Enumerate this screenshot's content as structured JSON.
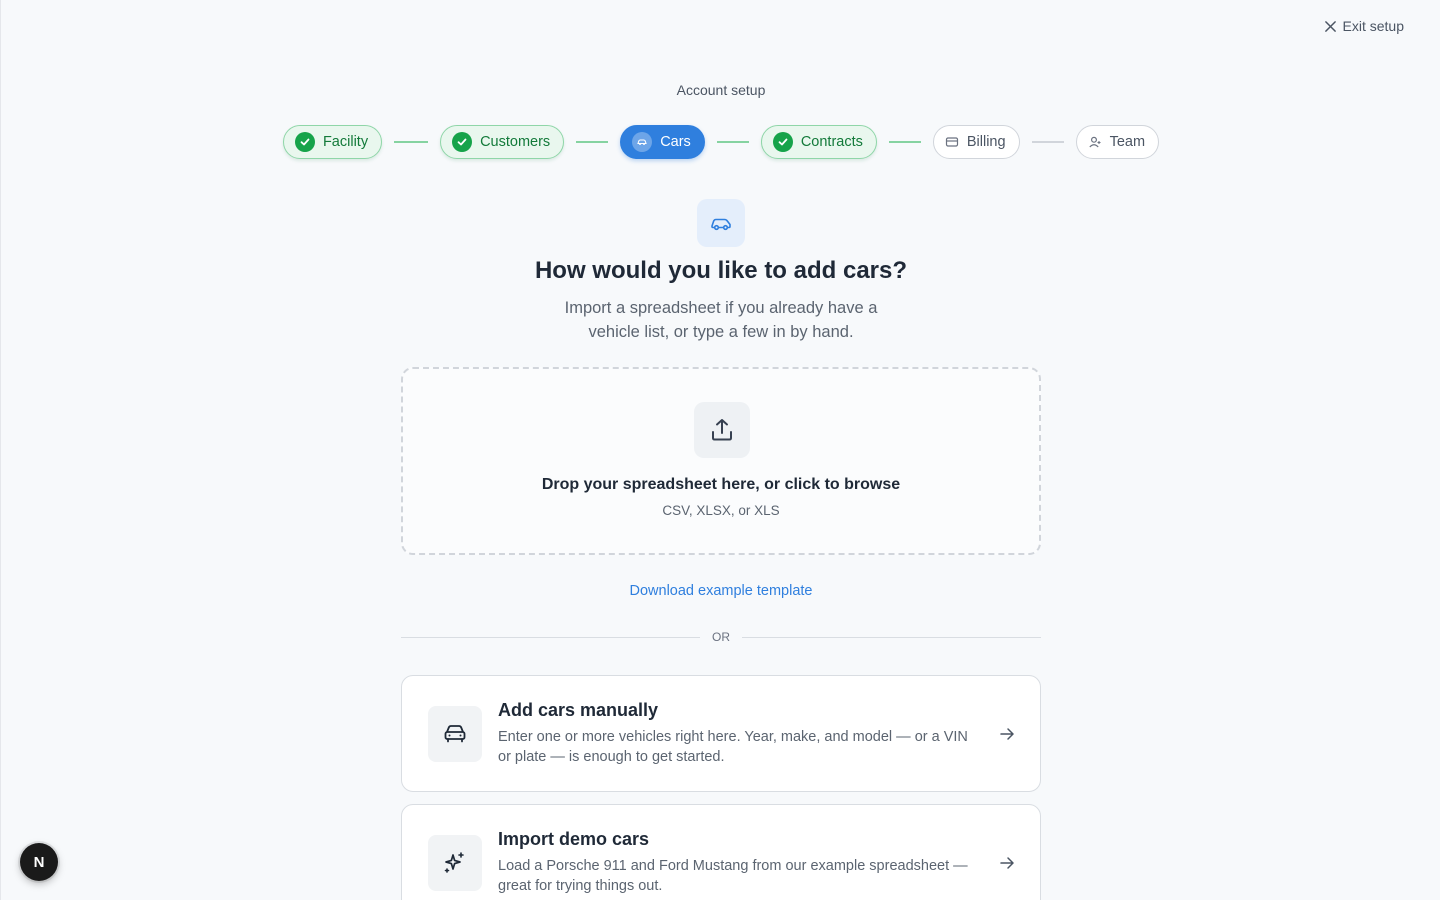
{
  "header": {
    "exit_label": "Exit setup",
    "title": "Account setup"
  },
  "steps": [
    {
      "label": "Facility",
      "status": "done",
      "icon": "check-icon"
    },
    {
      "label": "Customers",
      "status": "done",
      "icon": "check-icon"
    },
    {
      "label": "Cars",
      "status": "active",
      "icon": "car-icon"
    },
    {
      "label": "Contracts",
      "status": "done",
      "icon": "check-icon"
    },
    {
      "label": "Billing",
      "status": "todo",
      "icon": "credit-card-icon"
    },
    {
      "label": "Team",
      "status": "todo",
      "icon": "user-icon"
    }
  ],
  "hero": {
    "icon": "car-icon",
    "title": "How would you like to add cars?",
    "subtitle": "Import a spreadsheet if you already have a vehicle list, or type a few in by hand."
  },
  "dropzone": {
    "icon": "upload-icon",
    "title": "Drop your spreadsheet here, or click to browse",
    "hint": "CSV, XLSX, or XLS"
  },
  "template_link": "Download example template",
  "divider_label": "OR",
  "options": [
    {
      "icon": "car-front-icon",
      "title": "Add cars manually",
      "description": "Enter one or more vehicles right here. Year, make, and model — or a VIN or plate — is enough to get started."
    },
    {
      "icon": "sparkles-icon",
      "title": "Import demo cars",
      "description": "Load a Porsche 911 and Ford Mustang from our example spreadsheet — great for trying things out."
    }
  ],
  "floating_badge": "N",
  "colors": {
    "accent": "#2f7fde",
    "done_green": "#16a34a",
    "done_bg": "#e9f7ee",
    "background": "#f7f9fb"
  }
}
